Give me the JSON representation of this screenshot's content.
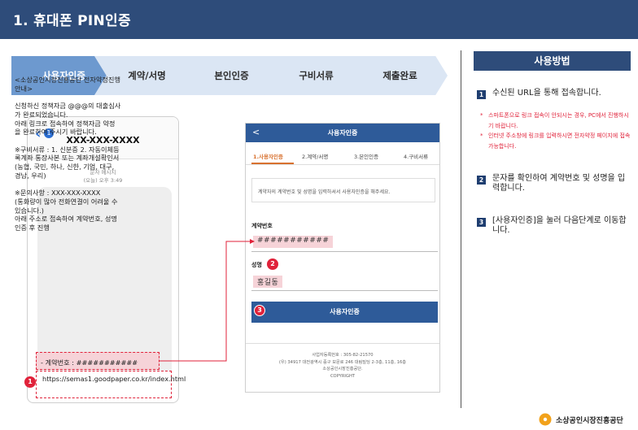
{
  "header": {
    "title": "1. 휴대폰 PIN인증"
  },
  "steps": [
    "사용자인증",
    "계약/서명",
    "본인인증",
    "구비서류",
    "제출완료"
  ],
  "phone": {
    "back_badge": "1",
    "sender": "XXX-XXX-XXXX",
    "meta_line1": "문자 메시지",
    "meta_line2": "(오늘) 오후 3:49",
    "message": "<소상공인시장진흥공단 전자약정진행\n안내>\n\n신청하신 정책자금 @@@의 대출심사\n가 완료되었습니다.\n아래 링크로 접속하여 정책자금 약정\n을 완료하여 주시기 바랍니다.\n\n※구비서류 : 1. 신분증 2. 자동이체등\n록계좌 통장사본 또는 계좌개설확인서\n(농협, 국민, 하나, 신한, 기업, 대구,\n경남, 우리)\n\n※문의사항 : XXX-XXX-XXXX\n(통화량이 많아 전화연결이 어려울 수\n있습니다.)\n아래 주소로 접속하여 계약번호, 성명\n인증 후 진행",
    "account_line": "- 계약번호 : ###########",
    "url": "https://semas1.goodpaper.co.kr/index.html"
  },
  "web": {
    "back": "<",
    "title": "사용자인증",
    "tabs": [
      "1.사용자인증",
      "2.계약/서명",
      "3.본인인증",
      "4.구비서류"
    ],
    "info": "계약자의 계약번호 및 성명을 입력하셔서 사용자인증을 해주세요.",
    "contract_label": "계약번호",
    "contract_value": "###########",
    "name_label": "성명",
    "name_value": "홍길동",
    "submit_label": "사용자인증",
    "footer_line1": "사업자등록번호 : 305-82-21570",
    "footer_line2": "(우) 34917 대전광역시 중구 보문로 246 대림빌딩 2-3층, 11층, 16층",
    "footer_line3": "소상공인시장진흥공단.",
    "footer_line4": "COPYRIGHT"
  },
  "markers": {
    "one": "1",
    "two": "2",
    "three": "3"
  },
  "side": {
    "title": "사용방법",
    "steps": [
      {
        "num": "1",
        "text": "수신된 URL을 통해 접속합니다."
      },
      {
        "num": "2",
        "text": "문자를 확인하여 계약번호 및 성명을 입력합니다."
      },
      {
        "num": "3",
        "text": "[사용자인증]을 눌러 다음단계로 이동합니다."
      }
    ],
    "notes": [
      {
        "star": "*",
        "text": "스마트폰으로 링크 접속이 안되시는 경우, PC에서 진행하시기 바랍니다."
      },
      {
        "star": "*",
        "text": "인터넷 주소창에 링크를 입력하시면 전자약정 페이지에 접속 가능합니다."
      }
    ]
  },
  "logo": {
    "text": "소상공인시장진흥공단"
  },
  "colors": {
    "header": "#2e4c7a",
    "accent_red": "#e0223a",
    "step_active": "#6d99cf",
    "step_inactive": "#dbe6f4",
    "web_blue": "#2e5b99",
    "tab_orange": "#d8712f"
  }
}
